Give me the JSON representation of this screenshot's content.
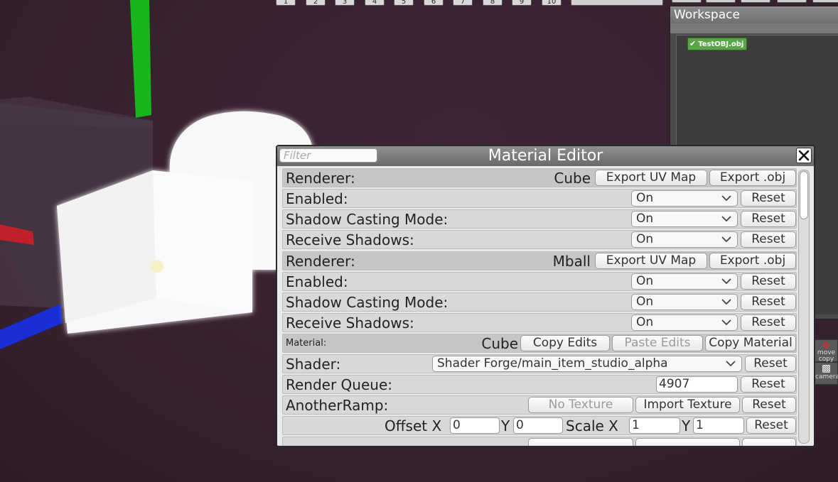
{
  "toolbar": {
    "number_buttons": [
      "1",
      "2",
      "3",
      "4",
      "5",
      "6",
      "7",
      "8",
      "9",
      "10"
    ]
  },
  "workspace": {
    "title": "Workspace",
    "items": [
      {
        "label": "TestOBJ.obj",
        "checked": true
      }
    ]
  },
  "side_icons": {
    "move_copy": "move copy",
    "camera": "camera"
  },
  "material_editor": {
    "title": "Material Editor",
    "filter_placeholder": "Filter",
    "renderer_1": {
      "label": "Renderer:",
      "name": "Cube",
      "export_uv_label": "Export UV Map",
      "export_obj_label": "Export .obj",
      "enabled": {
        "label": "Enabled:",
        "value": "On",
        "reset": "Reset"
      },
      "shadow_casting": {
        "label": "Shadow Casting Mode:",
        "value": "On",
        "reset": "Reset"
      },
      "receive_shadows": {
        "label": "Receive Shadows:",
        "value": "On",
        "reset": "Reset"
      }
    },
    "renderer_2": {
      "label": "Renderer:",
      "name": "Mball",
      "export_uv_label": "Export UV Map",
      "export_obj_label": "Export .obj",
      "enabled": {
        "label": "Enabled:",
        "value": "On",
        "reset": "Reset"
      },
      "shadow_casting": {
        "label": "Shadow Casting Mode:",
        "value": "On",
        "reset": "Reset"
      },
      "receive_shadows": {
        "label": "Receive Shadows:",
        "value": "On",
        "reset": "Reset"
      }
    },
    "material": {
      "label": "Material:",
      "name": "Cube",
      "copy_edits": "Copy Edits",
      "paste_edits": "Paste Edits",
      "copy_material": "Copy Material"
    },
    "shader": {
      "label": "Shader:",
      "value": "Shader Forge/main_item_studio_alpha",
      "reset": "Reset"
    },
    "render_queue": {
      "label": "Render Queue:",
      "value": "4907",
      "reset": "Reset"
    },
    "another_ramp": {
      "label": "AnotherRamp:",
      "no_texture": "No Texture",
      "import_texture": "Import Texture",
      "reset": "Reset"
    },
    "offset_scale": {
      "offset_label": "Offset X",
      "offset_x": "0",
      "y_label": "Y",
      "offset_y": "0",
      "scale_label": "Scale X",
      "scale_x": "1",
      "scale_y_label": "Y",
      "scale_y": "1",
      "reset": "Reset"
    }
  },
  "colors": {
    "viewport_bg": "#3a2230",
    "axis_x": "#c0202a",
    "axis_y": "#19b51d",
    "axis_z": "#1a2ed8",
    "workspace_item": "#5aa547"
  }
}
